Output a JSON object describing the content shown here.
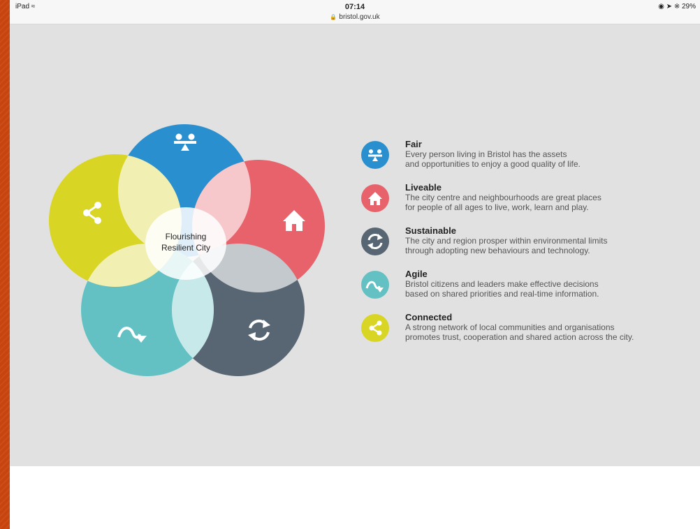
{
  "status": {
    "device": "iPad",
    "time": "07:14",
    "url": "bristol.gov.uk",
    "battery": "29%"
  },
  "diagram": {
    "center_line1": "Flourishing",
    "center_line2": "Resilient City"
  },
  "colors": {
    "fair": "#2a8fce",
    "liveable": "#e8626b",
    "sustainable": "#586573",
    "agile": "#63c1c3",
    "connected": "#d9d524"
  },
  "legend": [
    {
      "icon": "seesaw-icon",
      "title": "Fair",
      "line1": "Every person living in Bristol has the assets",
      "line2": "and opportunities to enjoy a good quality of life."
    },
    {
      "icon": "house-icon",
      "title": "Liveable",
      "line1": "The city centre and neighbourhoods are great places",
      "line2": "for people of all ages to live, work, learn and play."
    },
    {
      "icon": "cycle-arrows-icon",
      "title": "Sustainable",
      "line1": "The city and region prosper within environmental limits",
      "line2": "through adopting new behaviours and technology."
    },
    {
      "icon": "curved-arrow-icon",
      "title": "Agile",
      "line1": "Bristol citizens and leaders make effective decisions",
      "line2": "based on shared priorities and real-time information."
    },
    {
      "icon": "share-icon",
      "title": "Connected",
      "line1": "A strong network of local communities and organisations",
      "line2": "promotes trust, cooperation and shared action across the city."
    }
  ]
}
